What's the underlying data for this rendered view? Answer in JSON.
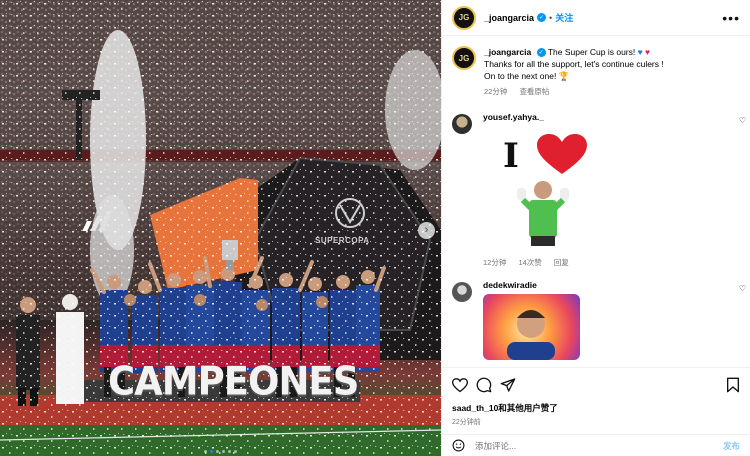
{
  "photo": {
    "banner_text": "CAMPEONES",
    "supercopa_text": "SUPERCOPA",
    "carousel_dot_count": 6,
    "carousel_active_dot": 2
  },
  "header": {
    "avatar_text": "JG",
    "username": "_joangarcia",
    "separator": "•",
    "follow_label": "关注",
    "more_label": "•••"
  },
  "caption": {
    "username": "_joangarcia",
    "line1": "The Super Cup is ours!",
    "line2": "Thanks for all the support, let's continue culers !",
    "line3": "On to the next one!",
    "time": "22分钟",
    "translate_label": "查看原帖"
  },
  "comments": [
    {
      "username": "yousef.yahya._",
      "gif_text": "I",
      "time": "12分钟",
      "likes": "14次赞",
      "reply_label": "回复"
    },
    {
      "username": "dedekwiradie"
    }
  ],
  "actions": {
    "liked_by": "saad_th_10和其他用户赞了",
    "time": "22分钟前"
  },
  "composer": {
    "placeholder": "添加评论...",
    "post_label": "发布"
  },
  "colors": {
    "link_blue": "#0095f6",
    "verified_blue": "#0095f6",
    "barca_blue": "#1f3f8f",
    "barca_red": "#b01c37",
    "adidas_orange": "#e8743b"
  }
}
